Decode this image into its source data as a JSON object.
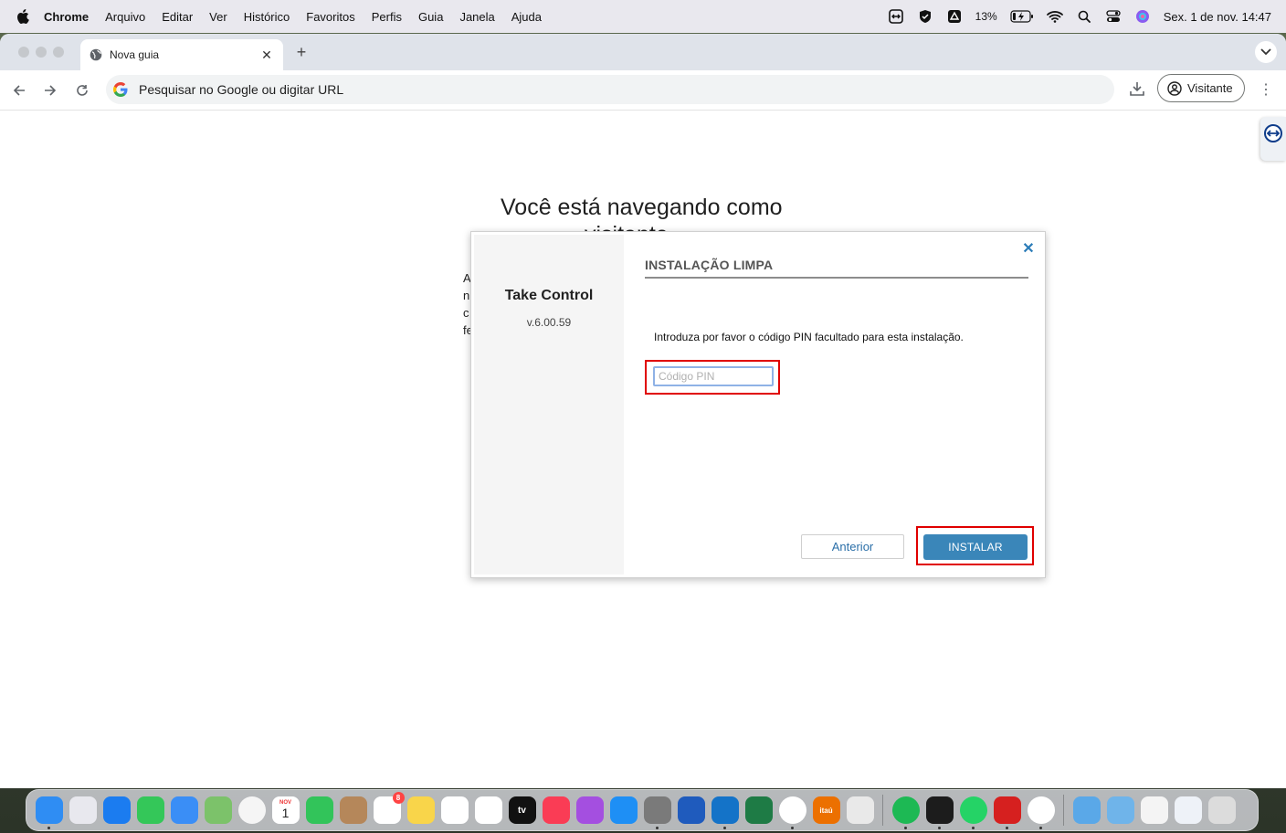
{
  "menubar": {
    "app_name": "Chrome",
    "items": [
      "Arquivo",
      "Editar",
      "Ver",
      "Histórico",
      "Favoritos",
      "Perfis",
      "Guia",
      "Janela",
      "Ajuda"
    ],
    "battery_percent": "13%",
    "datetime": "Sex. 1 de nov.  14:47"
  },
  "browser": {
    "tab_title": "Nova guia",
    "omnibox_placeholder": "Pesquisar no Google ou digitar URL",
    "profile_label": "Visitante"
  },
  "page": {
    "guest_heading": "Você está navegando como",
    "guest_heading_line2": "visitante",
    "guest_fragments": [
      "A",
      "n",
      "c",
      "fe"
    ]
  },
  "dialog": {
    "product_name": "Take Control",
    "product_version": "v.6.00.59",
    "title": "INSTALAÇÃO LIMPA",
    "instruction": "Introduza por favor o código PIN facultado para esta instalação.",
    "pin_placeholder": "Código PIN",
    "pin_value": "",
    "prev_label": "Anterior",
    "install_label": "INSTALAR"
  },
  "dock": {
    "calendar_month": "NOV",
    "calendar_day": "1",
    "reminders_badge": "8",
    "appletv_label": "tv",
    "itau_label": "itaú",
    "icons": [
      {
        "name": "finder-icon",
        "color": "#2f8df3"
      },
      {
        "name": "launchpad-icon",
        "color": "#e8e8ee"
      },
      {
        "name": "safari-icon",
        "color": "#1b7cf0"
      },
      {
        "name": "messages-icon",
        "color": "#34c759"
      },
      {
        "name": "mail-icon",
        "color": "#3a8ef6"
      },
      {
        "name": "maps-icon",
        "color": "#7cc26a"
      },
      {
        "name": "photos-icon",
        "color": "#f5f5f5"
      },
      {
        "name": "calendar-icon",
        "color": "#ffffff"
      },
      {
        "name": "facetime-icon",
        "color": "#32c45a"
      },
      {
        "name": "contacts-icon",
        "color": "#b5875a"
      },
      {
        "name": "reminders-icon",
        "color": "#ffffff"
      },
      {
        "name": "notes-icon",
        "color": "#f9d54a"
      },
      {
        "name": "freeform-icon",
        "color": "#ffffff"
      },
      {
        "name": "google-drive-icon",
        "color": "#ffffff"
      },
      {
        "name": "apple-tv-icon",
        "color": "#111111"
      },
      {
        "name": "music-icon",
        "color": "#fa3c55"
      },
      {
        "name": "podcasts-icon",
        "color": "#a44fe0"
      },
      {
        "name": "app-store-icon",
        "color": "#1e8ff5"
      },
      {
        "name": "system-settings-icon",
        "color": "#7a7a7a"
      },
      {
        "name": "word-icon",
        "color": "#1f5bbd"
      },
      {
        "name": "outlook-icon",
        "color": "#1473c8"
      },
      {
        "name": "excel-icon",
        "color": "#1e7b45"
      },
      {
        "name": "chrome-icon",
        "color": "#ffffff"
      },
      {
        "name": "itau-icon",
        "color": "#ec7000"
      },
      {
        "name": "phone-mirroring-icon",
        "color": "#e9e9e9"
      },
      {
        "name": "spotify-icon",
        "color": "#1db954"
      },
      {
        "name": "terminal-icon",
        "color": "#1c1c1c"
      },
      {
        "name": "whatsapp-icon",
        "color": "#25d366"
      },
      {
        "name": "acrobat-icon",
        "color": "#d6201f"
      },
      {
        "name": "chrome-canary-icon",
        "color": "#ffffff"
      },
      {
        "name": "folder-icon",
        "color": "#5aa8e8"
      },
      {
        "name": "downloads-folder-icon",
        "color": "#6fb4ea"
      },
      {
        "name": "recent-window-thumbnail-1",
        "color": "#f4f4f4"
      },
      {
        "name": "recent-window-thumbnail-2",
        "color": "#eef2f8"
      },
      {
        "name": "trash-icon",
        "color": "#dcdcdc"
      }
    ]
  },
  "colors": {
    "accent": "#3a86b9",
    "highlight_box": "#e00000",
    "close_x": "#2b7cb8"
  }
}
